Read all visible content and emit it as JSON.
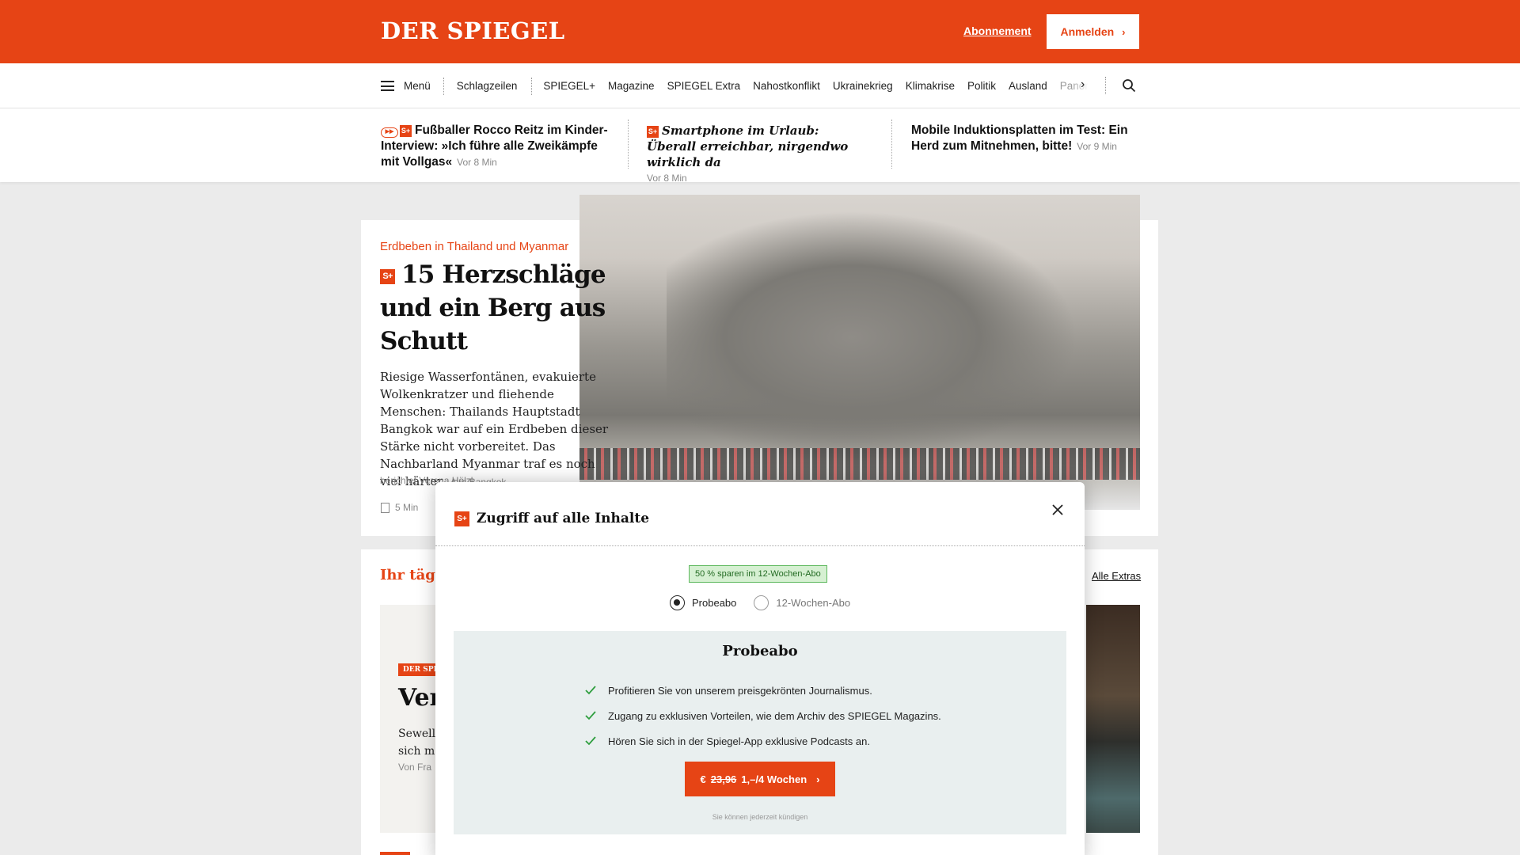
{
  "header": {
    "logo": "DER SPIEGEL",
    "subscription_link": "Abonnement",
    "login_button": "Anmelden",
    "brand_color": "#e64415"
  },
  "nav": {
    "menu_label": "Menü",
    "items": [
      "Schlagzeilen",
      "SPIEGEL+",
      "Magazine",
      "SPIEGEL Extra",
      "Nahostkonflikt",
      "Ukrainekrieg",
      "Klimakrise",
      "Politik",
      "Ausland",
      "Panor"
    ],
    "more_icon": "chevron-right-icon",
    "search_icon": "search-icon"
  },
  "teasers": [
    {
      "badge": "S+",
      "title": "Fußballer Rocco Reitz im Kinder-Interview: »Ich führe alle Zweikämpfe mit Vollgas«",
      "time": "Vor 8 Min"
    },
    {
      "badge": "S+",
      "title": "Smartphone im Urlaub: Überall erreichbar, nirgendwo wirklich da",
      "time": "Vor 8 Min"
    },
    {
      "title": "Mobile Induktionsplatten im Test: Ein Herd zum Mitnehmen, bitte!",
      "time": "Vor 9 Min"
    }
  ],
  "main_article": {
    "kicker": "Erdbeben in Thailand und Myanmar",
    "badge": "S+",
    "headline": "15 Herzschläge und ein Berg aus Schutt",
    "lead": "Riesige Wasserfontänen, evakuierte Wolkenkratzer und fliehende Menschen: Thailands Hauptstadt Bangkok war auf ein Erdbeben dieser Stärke nicht vorbereitet. Das Nachbarland Myanmar traf es noch viel härter.",
    "author_prefix": "Aus Bangkok",
    "author_line": "berichtet Verena Hölzl",
    "read_time": "5 Min"
  },
  "section2": {
    "title": "Ihr täglic",
    "all_link": "Alle Extras",
    "promo_badge": "DER SPIEGEL",
    "promo_title": "Ver",
    "promo_text_1": "Sewell",
    "promo_text_2": "sich m",
    "promo_by": "Von Fra"
  },
  "modal": {
    "badge": "S+",
    "title": "Zugriff auf alle Inhalte",
    "close_icon": "close-icon",
    "save_pill": "50 % sparen im 12-Wochen-Abo",
    "options": [
      {
        "label": "Probeabo",
        "selected": true
      },
      {
        "label": "12-Wochen-Abo",
        "selected": false
      }
    ],
    "box_title": "Probeabo",
    "benefits": [
      "Profitieren Sie von unserem preisgekrönten Journalismus.",
      "Zugang zu exklusiven Vorteilen, wie dem Archiv des SPIEGEL Magazins.",
      "Hören Sie sich in der Spiegel-App exklusive Podcasts an."
    ],
    "cta_currency": "€",
    "cta_old_price": "23,96",
    "cta_price": "1,–/4 Wochen",
    "cancel_note": "Sie können jederzeit kündigen",
    "check_color": "#2e9e3e"
  }
}
